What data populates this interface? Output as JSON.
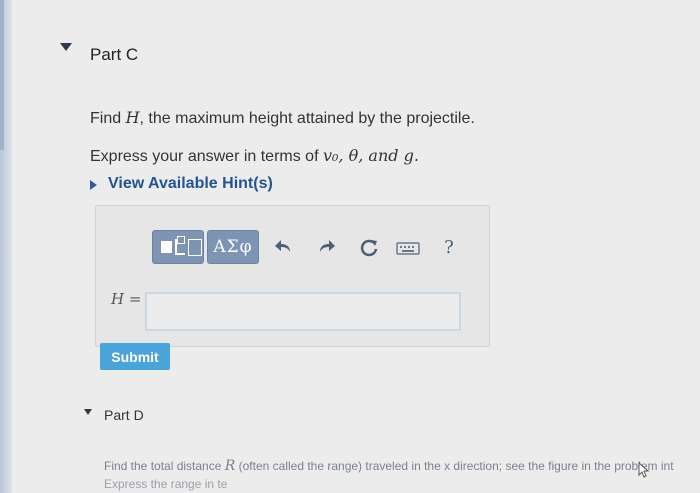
{
  "part_c": {
    "title": "Part C",
    "question_prefix": "Find ",
    "question_var": "H",
    "question_suffix": ", the maximum height attained by the projectile.",
    "express_prefix": "Express your answer in terms of ",
    "express_vars": "v₀, θ, and g.",
    "hints_link": "View Available Hint(s)"
  },
  "toolbar": {
    "symbols_label": "ΑΣφ",
    "help_label": "?"
  },
  "answer": {
    "label": "H =",
    "value": ""
  },
  "submit_label": "Submit",
  "part_d": {
    "title": "Part D",
    "text_line1_prefix": "Find the total distance ",
    "text_line1_var": "R",
    "text_line1_suffix": " (often called the range) traveled in the x direction; see the figure in the problem int",
    "text_line2": "Express the range in te"
  },
  "colors": {
    "accent": "#4aa3d9",
    "toolbar_blue": "#7d95b3",
    "link_blue": "#24548f"
  }
}
